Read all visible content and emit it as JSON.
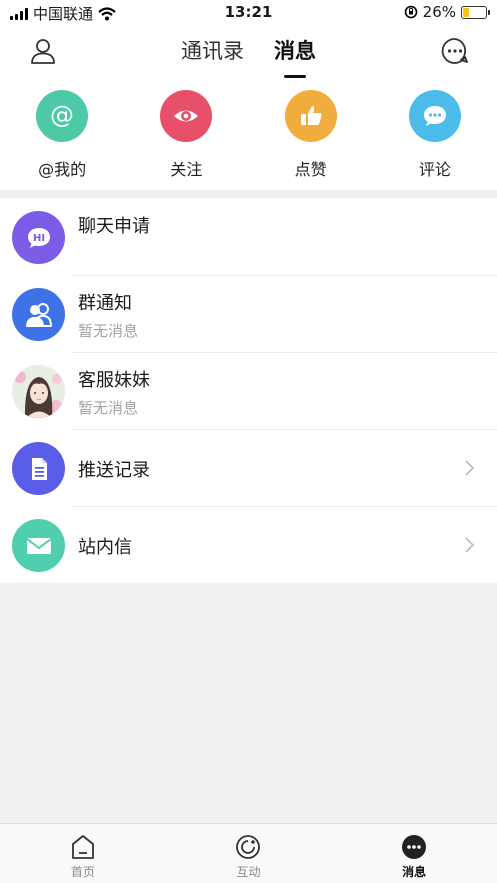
{
  "status_bar": {
    "carrier": "中国联通",
    "time": "13:21",
    "battery": "26%",
    "battery_level": 0.26
  },
  "header": {
    "tabs": [
      {
        "label": "通讯录",
        "active": false
      },
      {
        "label": "消息",
        "active": true
      }
    ],
    "left_icon": "user-icon",
    "right_icon": "chat-bubble-icon"
  },
  "quick_actions": [
    {
      "label": "@我的",
      "icon": "at-icon",
      "color": "#4dc9a8"
    },
    {
      "label": "关注",
      "icon": "eye-icon",
      "color": "#e8506a"
    },
    {
      "label": "点赞",
      "icon": "thumbs-up-icon",
      "color": "#f0ac3c"
    },
    {
      "label": "评论",
      "icon": "comment-icon",
      "color": "#4cbcea"
    }
  ],
  "messages": [
    {
      "title": "聊天申请",
      "subtitle": "",
      "icon": "hi-chat-icon",
      "color": "#7a5ce6",
      "has_chevron": false
    },
    {
      "title": "群通知",
      "subtitle": "暂无消息",
      "icon": "group-icon",
      "color": "#3e73e8",
      "has_chevron": false
    },
    {
      "title": "客服妹妹",
      "subtitle": "暂无消息",
      "icon": "avatar-photo",
      "color": "#f3d8d8",
      "has_chevron": false
    },
    {
      "title": "推送记录",
      "subtitle": "",
      "icon": "document-icon",
      "color": "#5a5de8",
      "has_chevron": true
    },
    {
      "title": "站内信",
      "subtitle": "",
      "icon": "mail-icon",
      "color": "#4fcfae",
      "has_chevron": true
    }
  ],
  "bottom_nav": [
    {
      "label": "首页",
      "icon": "home-icon",
      "active": false
    },
    {
      "label": "互动",
      "icon": "interact-icon",
      "active": false
    },
    {
      "label": "消息",
      "icon": "message-icon",
      "active": true
    }
  ]
}
